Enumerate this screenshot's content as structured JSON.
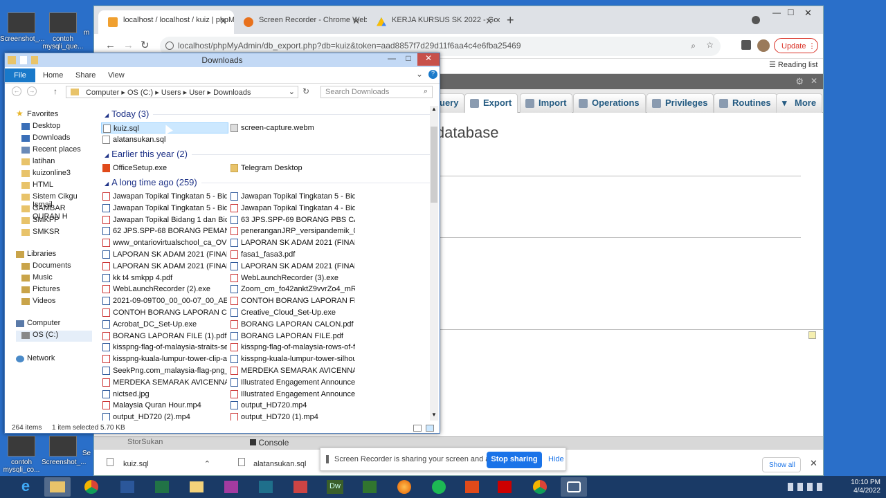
{
  "desktop": {
    "icons": [
      {
        "label": "Screenshot_..."
      },
      {
        "label": "contoh mysqli_que..."
      },
      {
        "label": "m"
      },
      {
        "label": "contoh mysqli_co..."
      },
      {
        "label": "Screenshot_..."
      },
      {
        "label": "Se"
      }
    ]
  },
  "browser": {
    "tabs": [
      {
        "label": "localhost / localhost / kuiz | phpM"
      },
      {
        "label": "Screen Recorder - Chrome Web"
      },
      {
        "label": "KERJA KURSUS SK 2022 - Googl"
      }
    ],
    "url": "localhost/phpMyAdmin/db_export.php?db=kuiz&token=aad8857f7d29d11f6aa4c4e6fba25469",
    "update_label": "Update",
    "reading_list": "Reading list",
    "new_tab": "+",
    "tab_close": "✕",
    "window_min": "—",
    "window_max": "□",
    "window_close": "✕"
  },
  "pma": {
    "tabs": [
      {
        "label": "uery"
      },
      {
        "label": "Export"
      },
      {
        "label": "Import"
      },
      {
        "label": "Operations"
      },
      {
        "label": "Privileges"
      },
      {
        "label": "Routines"
      },
      {
        "label": "More"
      }
    ],
    "heading": "\" database",
    "console_label": "Console",
    "left_label": "StorSukan"
  },
  "explorer": {
    "title": "Downloads",
    "ribbon": {
      "file": "File",
      "home": "Home",
      "share": "Share",
      "view": "View"
    },
    "breadcrumb": {
      "computer": "Computer",
      "osc": "OS (C:)",
      "users": "Users",
      "user": "User",
      "downloads": "Downloads"
    },
    "search_placeholder": "Search Downloads",
    "nav": {
      "favorites": "Favorites",
      "desktop": "Desktop",
      "downloads": "Downloads",
      "recent": "Recent places",
      "latihan": "latihan",
      "kuizonline3": "kuizonline3",
      "html": "HTML",
      "sistem": "Sistem Cikgu Ismail",
      "gambar": "GAMBAR QURAN H",
      "smkpp": "SMKPP",
      "smksr": "SMKSR",
      "libraries": "Libraries",
      "documents": "Documents",
      "music": "Music",
      "pictures": "Pictures",
      "videos": "Videos",
      "computer": "Computer",
      "osc": "OS (C:)",
      "network": "Network"
    },
    "groups": {
      "today": "Today (3)",
      "earlier": "Earlier this year (2)",
      "longago": "A long time ago (259)"
    },
    "today_files": [
      "kuiz.sql",
      "screen-capture.webm",
      "alatansukan.sql"
    ],
    "earlier_files": [
      "OfficeSetup.exe",
      "Telegram Desktop"
    ],
    "long_files": [
      "Jawapan Topikal Tingkatan 5 - Bidan...",
      "Jawapan Topikal Tingkatan 5 - Bidan...",
      "Jawapan Topikal Tingkatan 5 - Bidan...",
      "Jawapan Topikal Tingkatan 4 - Bidan...",
      "Jawapan Topikal Bidang 1 dan Bidan...",
      "63 JPS.SPP-69 BORANG PBS CALON ...",
      "62 JPS.SPP-68 BORANG PEMANTAU...",
      "peneranganJRP_versipandemik_0508...",
      "www_ontariovirtualschool_ca_OVS_I...",
      "LAPORAN SK ADAM 2021 (FINAL) (F...",
      "LAPORAN SK ADAM 2021 (FINAL) (F...",
      "fasa1_fasa3.pdf",
      "LAPORAN SK ADAM 2021 (FINAL) (F...",
      "LAPORAN SK ADAM 2021 (FINAL) (F...",
      "kk t4 smkpp 4.pdf",
      "WebLaunchRecorder (3).exe",
      "WebLaunchRecorder (2).exe",
      "Zoom_cm_fo42anktZ9vvrZo4_mRNI...",
      "2021-09-09T00_00_00-07_00_AE0031...",
      "CONTOH BORANG LAPORAN FILE (...",
      "CONTOH BORANG LAPORAN CALO...",
      "Creative_Cloud_Set-Up.exe",
      "Acrobat_DC_Set-Up.exe",
      "BORANG LAPORAN CALON.pdf",
      "BORANG LAPORAN FILE (1).pdf",
      "BORANG LAPORAN FILE.pdf",
      "kisspng-flag-of-malaysia-straits-sett...",
      "kisspng-flag-of-malaysia-rows-of-fl...",
      "kisspng-kuala-lumpur-tower-clip-ar...",
      "kisspng-kuala-lumpur-tower-silhou...",
      "SeekPng.com_malaysia-flag-png_40...",
      "MERDEKA SEMARAK AVICENNA (1)....",
      "MERDEKA SEMARAK AVICENNA.png",
      "Illustrated Engagement Announcem...",
      "nictsed.jpg",
      "Illustrated Engagement Announcem...",
      "Malaysia Quran Hour.mp4",
      "output_HD720.mp4",
      "output_HD720 (2).mp4",
      "output_HD720 (1).mp4"
    ],
    "status_items": "264 items",
    "status_selected": "1 item selected  5.70 KB",
    "title_min": "—",
    "title_max": "□",
    "title_close": "✕"
  },
  "download_shelf": {
    "items": [
      "kuiz.sql",
      "alatansukan.sql"
    ],
    "show_all": "Show all",
    "close": "✕"
  },
  "share_bar": {
    "message": "Screen Recorder is sharing your screen and audio.",
    "stop_label": "Stop sharing",
    "hide_label": "Hide"
  },
  "taskbar": {
    "time": "10:10 PM",
    "date": "4/4/2022",
    "dw_label": "Dw"
  },
  "colors": {
    "accent": "#1a73e8",
    "selection": "#cce8ff",
    "taskbar": "#1a3a66"
  }
}
